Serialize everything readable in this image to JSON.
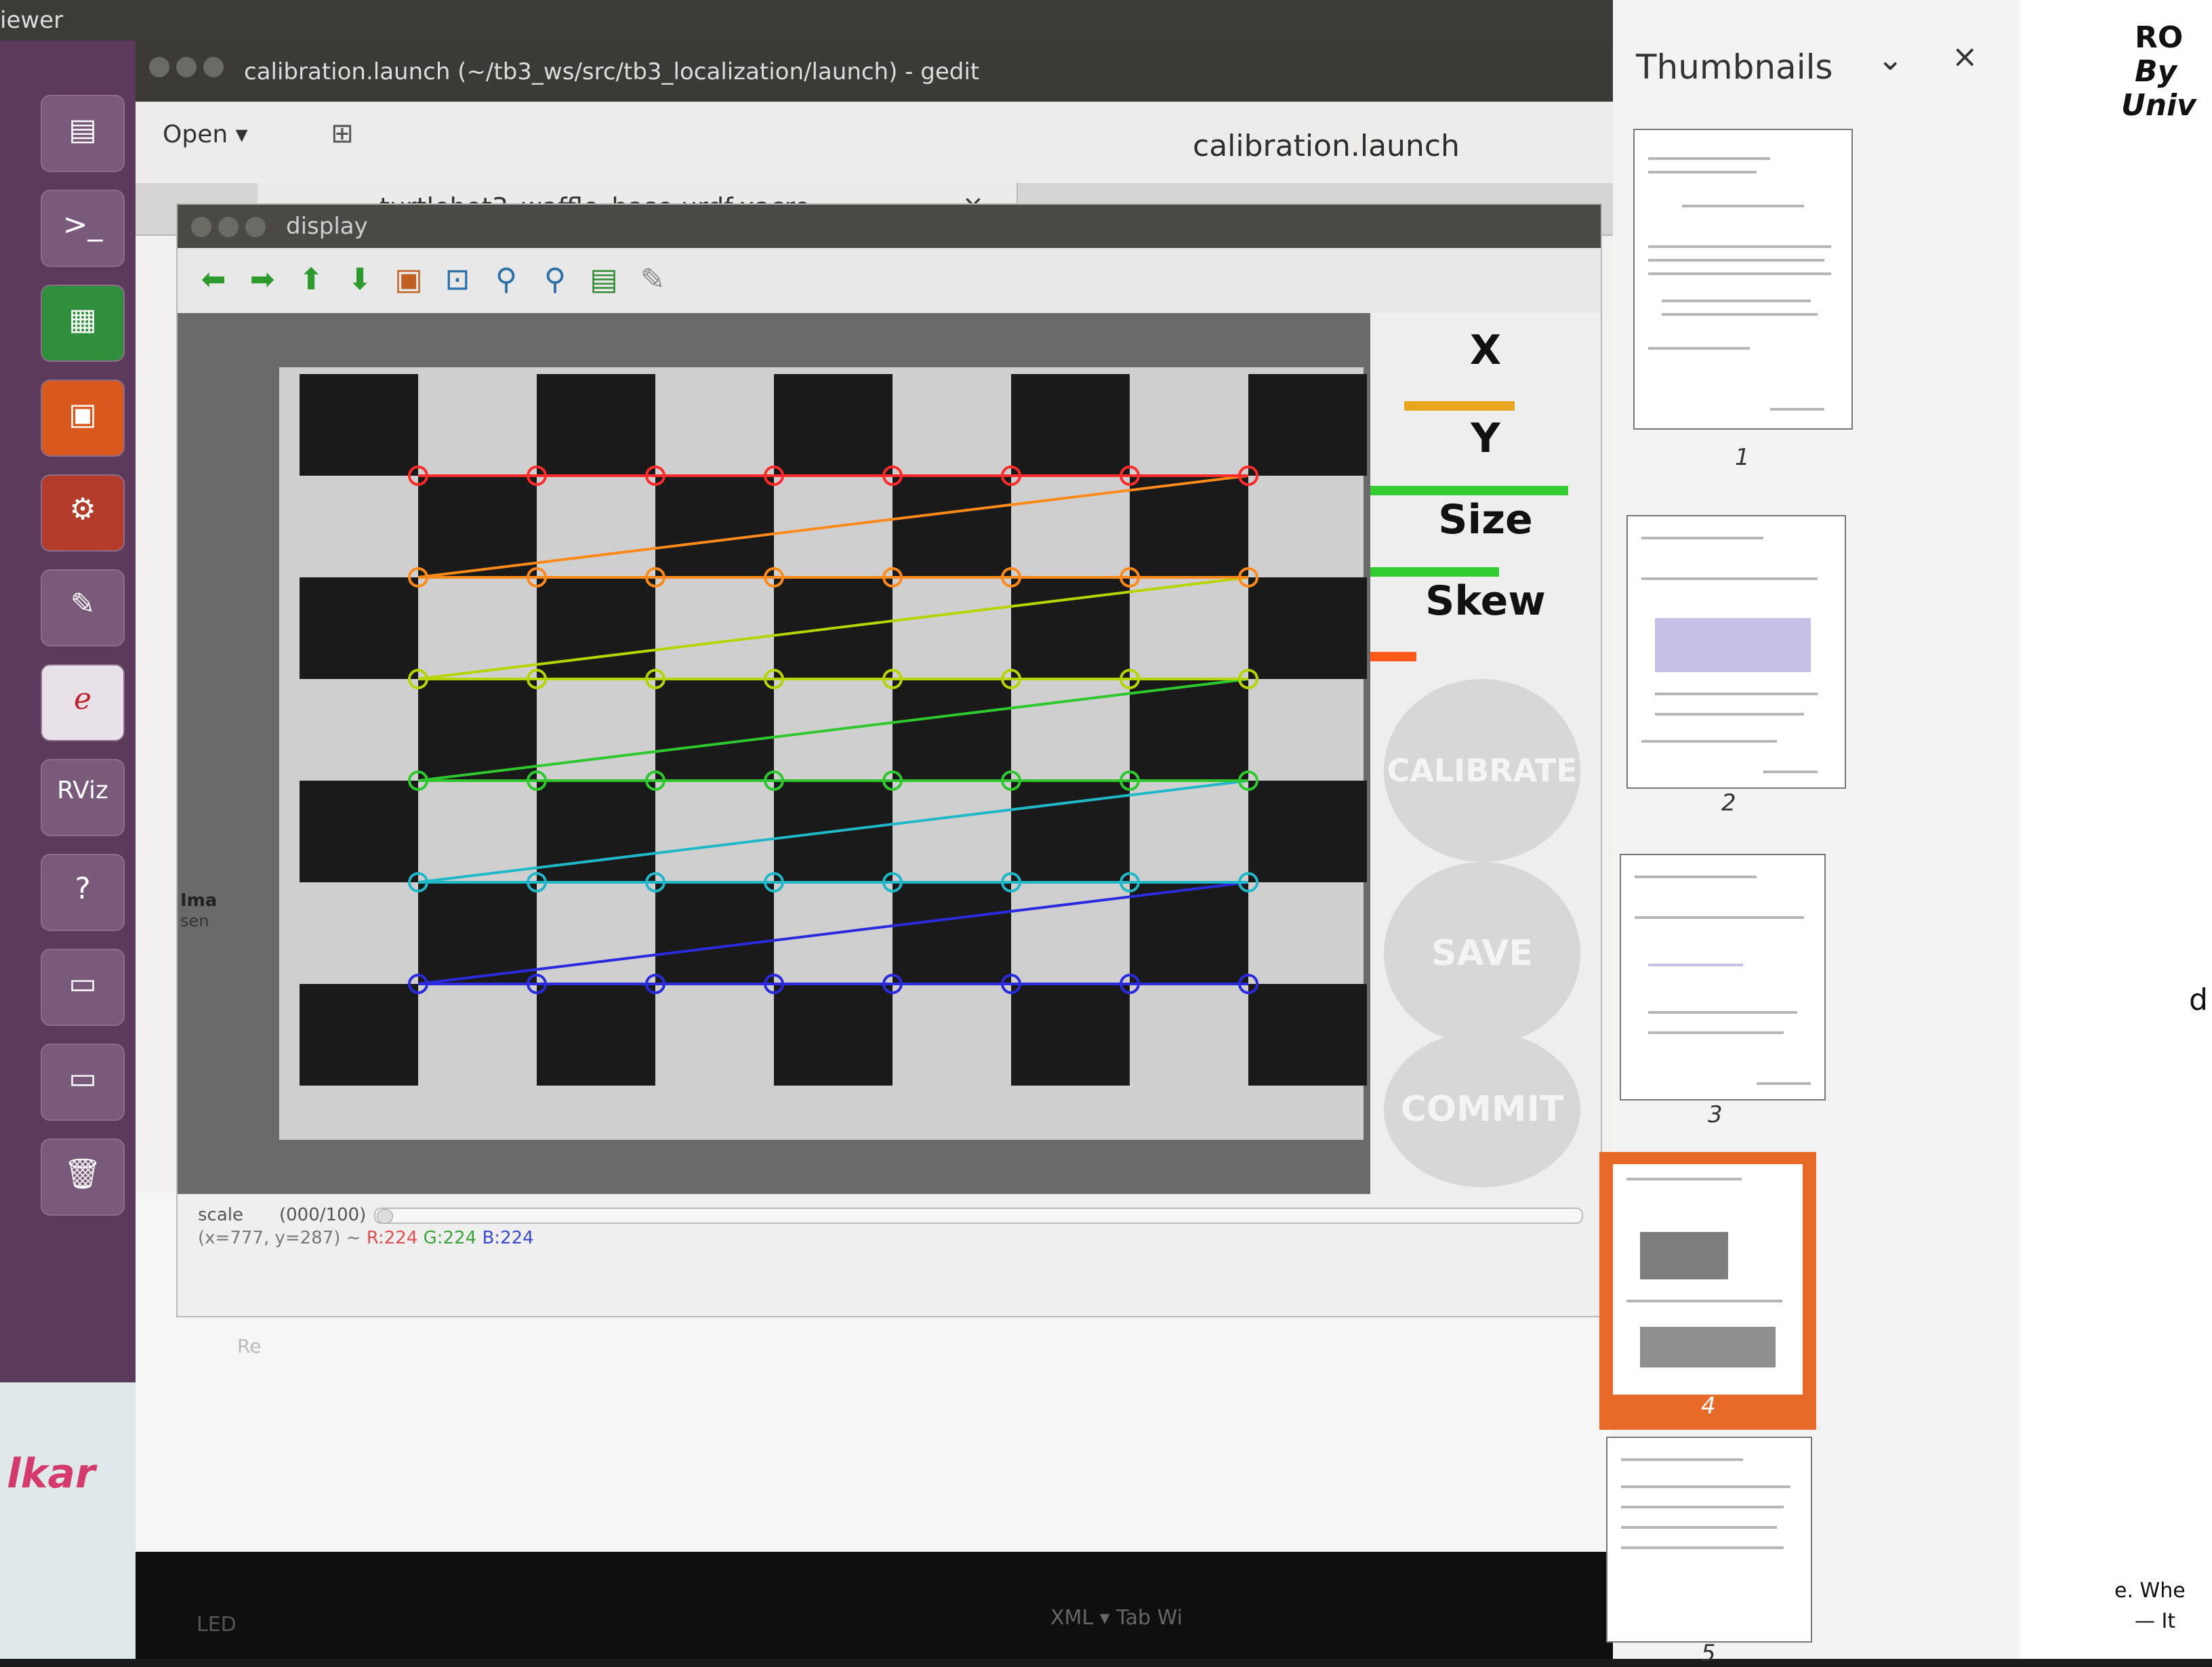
{
  "top_bar": {
    "title": "iewer"
  },
  "launcher": {
    "items": [
      {
        "icon": "files-icon",
        "glyph": "▤"
      },
      {
        "icon": "terminal-icon",
        "glyph": ">_"
      },
      {
        "icon": "spreadsheet-icon",
        "glyph": "▦"
      },
      {
        "icon": "presentation-icon",
        "glyph": "▣"
      },
      {
        "icon": "settings-icon",
        "glyph": "⚙"
      },
      {
        "icon": "text-editor-icon",
        "glyph": "✎"
      },
      {
        "icon": "pdf-viewer-icon",
        "glyph": "ℯ"
      },
      {
        "icon": "rviz-icon",
        "glyph": "RViz"
      },
      {
        "icon": "help-icon",
        "glyph": "?"
      },
      {
        "icon": "drive-icon",
        "glyph": "▭"
      },
      {
        "icon": "drive2-icon",
        "glyph": "▭"
      },
      {
        "icon": "trash-icon",
        "glyph": "🗑"
      }
    ]
  },
  "gedit": {
    "window_title": "calibration.launch (~/tb3_ws/src/tb3_localization/launch) - gedit",
    "open_label": "Open ▾",
    "doc_title": "calibration.launch",
    "tab_label": "turtlebot3_waffle_base.urdf.xacro",
    "tab_close": "×",
    "ghost_lines": [
      "RO",
      "Re"
    ],
    "status": "XML ▾   Tab Width ▾"
  },
  "display": {
    "title": "display",
    "left_snip": [
      "Ima",
      "sen"
    ],
    "scale_label": "scale",
    "scale_value": "(000/100)",
    "status_coords": "(x=777, y=287) ~ ",
    "status_r": "R:224",
    "status_g": "G:224",
    "status_b": "B:224",
    "metrics": {
      "x": "X",
      "y": "Y",
      "size": "Size",
      "skew": "Skew",
      "bar_x": 0.48,
      "bar_y": 0.86,
      "bar_size": 0.56,
      "bar_skew": 0.2
    },
    "buttons": {
      "calibrate": "CALIBRATE",
      "save": "SAVE",
      "commit": "COMMIT"
    },
    "colors": {
      "rows": [
        "#ff2a2a",
        "#ff8a1a",
        "#b8d400",
        "#2ec82e",
        "#20b8c8",
        "#2a2adf"
      ],
      "bar_x": "#e8a520",
      "bar_y": "#33cc33",
      "bar_size": "#33cc33",
      "bar_skew": "#ff5a1a"
    }
  },
  "thumbnails": {
    "title": "Thumbnails",
    "pages": [
      "1",
      "2",
      "3",
      "4",
      "5"
    ],
    "selected": "4"
  },
  "doc_peek": {
    "line1": "RO",
    "line2": "By",
    "line3": "Univ",
    "side": "d",
    "bottom1": "e. Whe",
    "bottom2": "— It"
  },
  "bezel": {
    "brand": "LED",
    "status": "XML ▾   Tab Wi"
  },
  "desk": {
    "label": "lkar"
  }
}
